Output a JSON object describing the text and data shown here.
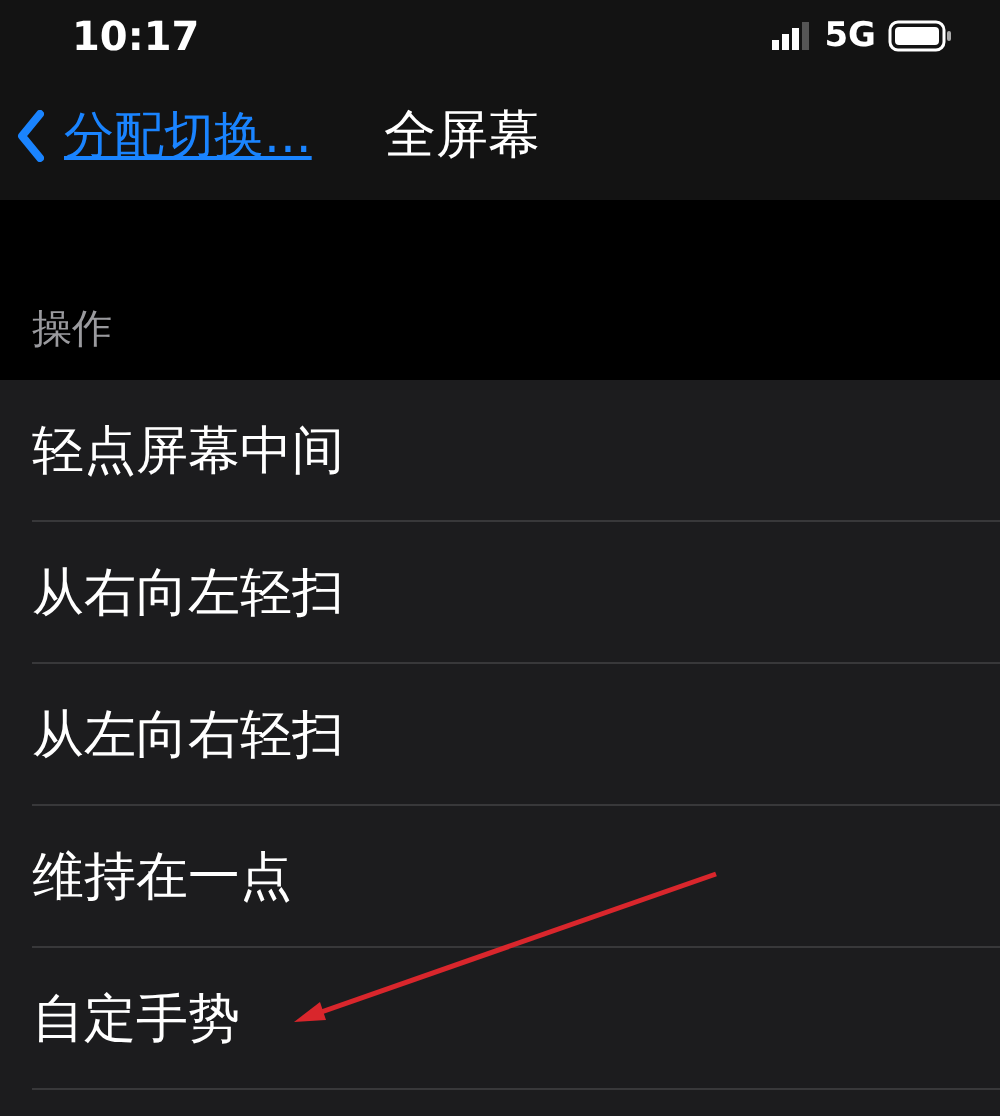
{
  "status_bar": {
    "time": "10:17",
    "network": "5G"
  },
  "nav_bar": {
    "back_label": "分配切换...",
    "title": "全屏幕"
  },
  "section": {
    "header": "操作",
    "items": [
      {
        "label": "轻点屏幕中间"
      },
      {
        "label": "从右向左轻扫"
      },
      {
        "label": "从左向右轻扫"
      },
      {
        "label": "维持在一点"
      },
      {
        "label": "自定手势"
      }
    ]
  }
}
